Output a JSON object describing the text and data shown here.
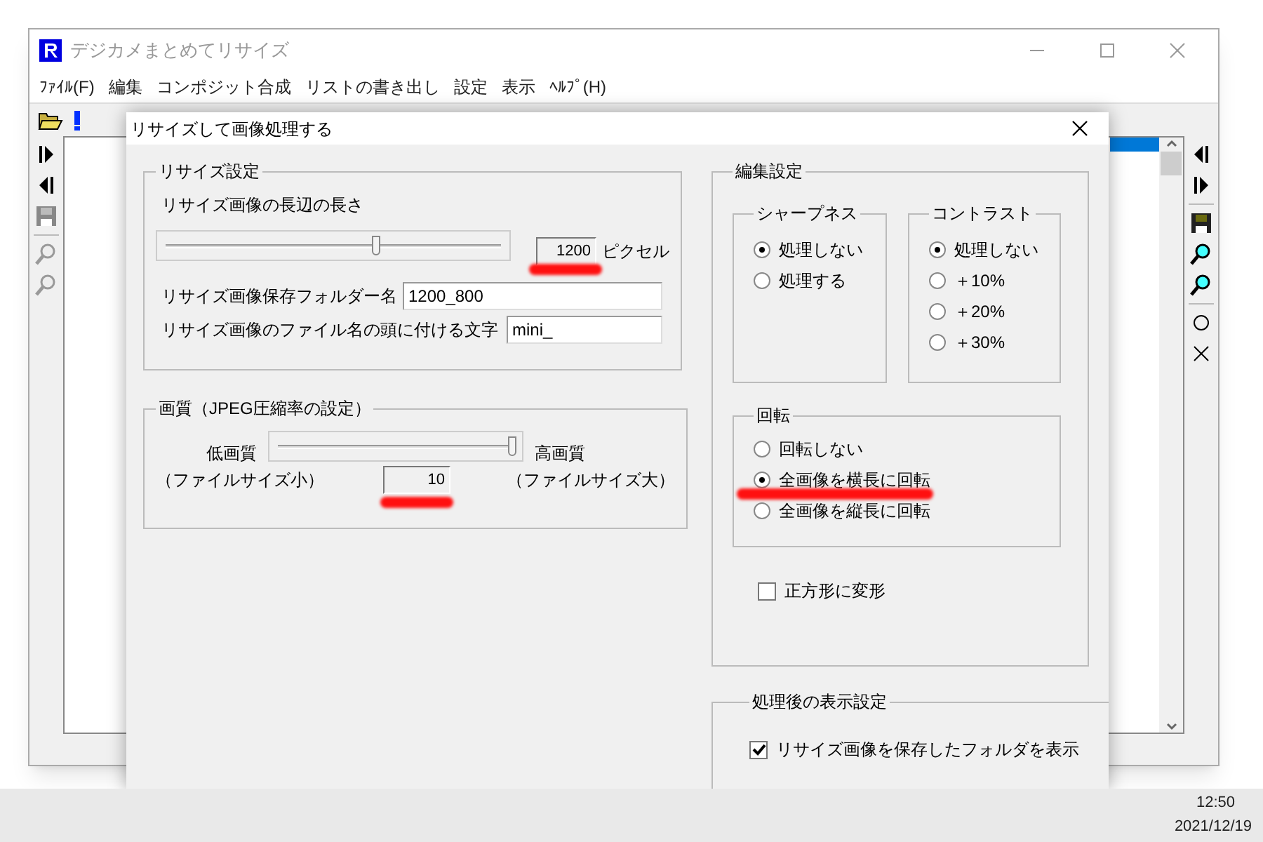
{
  "window": {
    "title": "デジカメまとめてリサイズ"
  },
  "menu": [
    "ﾌｧｲﾙ(F)",
    "編集",
    "コンポジット合成",
    "リストの書き出し",
    "設定",
    "表示",
    "ﾍﾙﾌﾟ(H)"
  ],
  "list": {
    "rows": [
      {
        "selected": true
      }
    ]
  },
  "dialog": {
    "title": "リサイズして画像処理する",
    "resize": {
      "title": "リサイズ設定",
      "length_label": "リサイズ画像の長辺の長さ",
      "length_slider": {
        "level": 0.63
      },
      "length_value": {
        "value": "1200",
        "highlighted": true
      },
      "length_unit": "ピクセル",
      "folder_label": "リサイズ画像保存フォルダー名",
      "folder_value": "1200_800",
      "prefix_label": "リサイズ画像のファイル名の頭に付ける文字",
      "prefix_value": "mini_"
    },
    "quality": {
      "title": "画質（JPEG圧縮率の設定）",
      "low_label": "低画質",
      "high_label": "高画質",
      "slider": {
        "level": 1
      },
      "low_note": "（ファイルサイズ小）",
      "value": {
        "value": "10",
        "highlighted": true
      },
      "high_note": "（ファイルサイズ大）"
    },
    "edit": {
      "title": "編集設定",
      "sharpness": {
        "title": "シャープネス",
        "options": [
          {
            "label": "処理しない",
            "selected": true
          },
          {
            "label": "処理する",
            "selected": false
          }
        ]
      },
      "contrast": {
        "title": "コントラスト",
        "options": [
          {
            "label": "処理しない",
            "selected": true
          },
          {
            "label": "＋10%",
            "selected": false
          },
          {
            "label": "＋20%",
            "selected": false
          },
          {
            "label": "＋30%",
            "selected": false
          }
        ]
      },
      "rotation": {
        "title": "回転",
        "options": [
          {
            "label": "回転しない",
            "selected": false,
            "highlighted": false
          },
          {
            "label": "全画像を横長に回転",
            "selected": true,
            "highlighted": true
          },
          {
            "label": "全画像を縦長に回転",
            "selected": false,
            "highlighted": false
          }
        ]
      },
      "square": {
        "label": "正方形に変形",
        "checked": false
      }
    },
    "display": {
      "title": "処理後の表示設定",
      "show_folder": {
        "label": "リサイズ画像を保存したフォルダを表示",
        "checked": true
      }
    }
  },
  "taskbar": {
    "time": "12:50",
    "date": "2021/12/19"
  }
}
